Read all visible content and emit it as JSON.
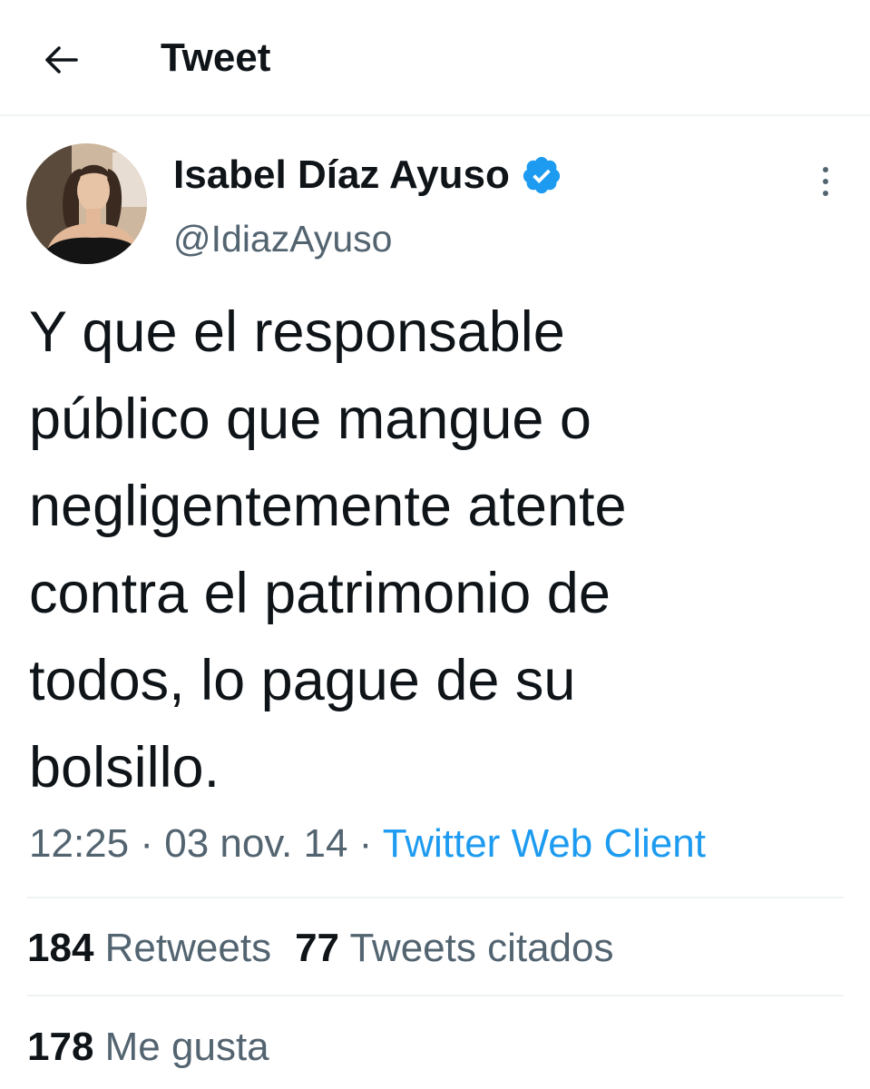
{
  "header": {
    "back_icon": "arrow-left-icon",
    "title": "Tweet"
  },
  "author": {
    "name": "Isabel Díaz Ayuso",
    "handle": "@IdiazAyuso",
    "verified_icon": "verified-badge-icon",
    "verified_color": "#1d9bf0",
    "more_icon": "more-vertical-icon"
  },
  "tweet": {
    "text": "Y que el responsable\npúblico que mangue o\nnegligentemente atente\ncontra el patrimonio de\ntodos, lo pague de su\nbolsillo.",
    "time": "12:25",
    "separator1": " · ",
    "date": "03 nov. 14",
    "separator2": " · ",
    "source": "Twitter Web Client"
  },
  "stats": {
    "retweets_count": "184",
    "retweets_label": "Retweets",
    "quotes_count": "77",
    "quotes_label": "Tweets citados",
    "likes_count": "178",
    "likes_label": "Me gusta"
  },
  "colors": {
    "text": "#0f1419",
    "secondary": "#536471",
    "accent": "#1d9bf0",
    "divider": "#eff3f4"
  }
}
